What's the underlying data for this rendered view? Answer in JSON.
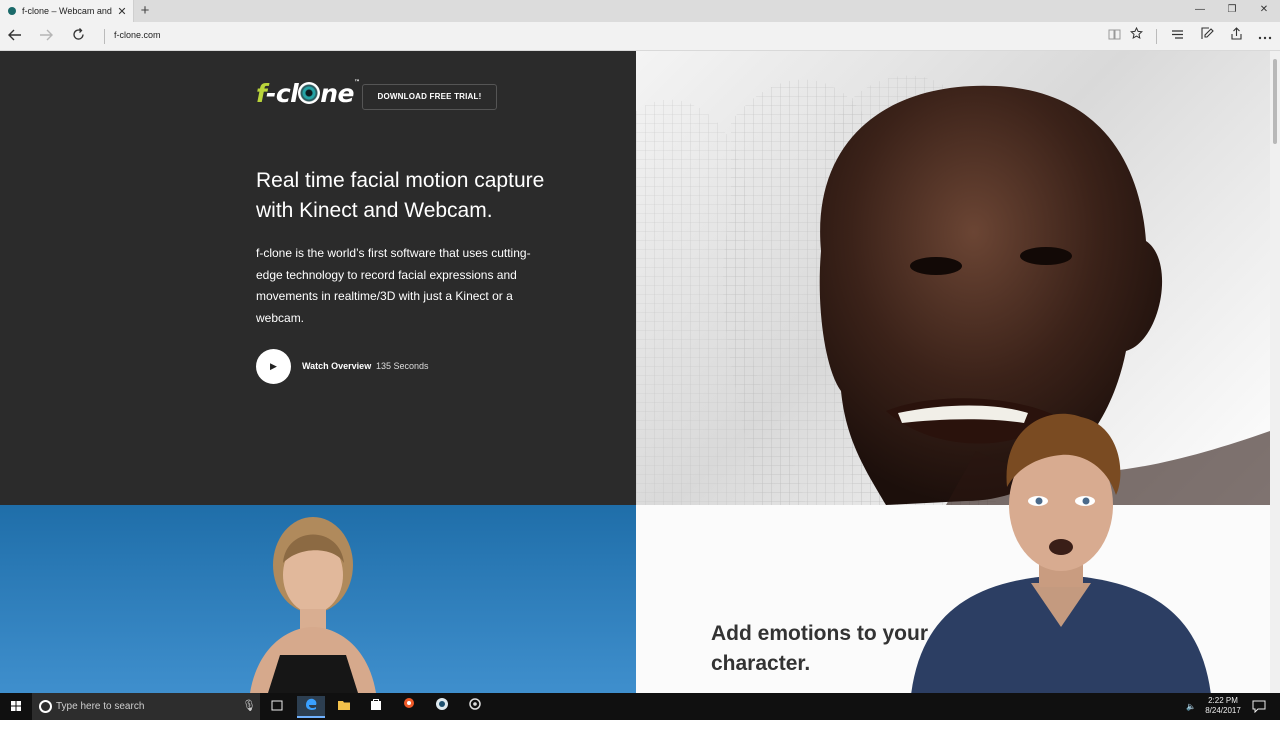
{
  "browser": {
    "tab_title": "f-clone – Webcam and I",
    "tab_close": "✕",
    "new_tab": "+",
    "url": "f-clone.com",
    "window_controls": [
      "—",
      "❐",
      "✕"
    ],
    "accent": "#b9d43a"
  },
  "page": {
    "logo": {
      "prefix": "f",
      "middle": "-cl",
      "suffix": "ne",
      "tm": "™"
    },
    "download_button": "DOWNLOAD FREE TRIAL!",
    "headline": "Real time facial motion capture with Kinect and Webcam.",
    "description": "f-clone is the world’s first software that uses cutting-edge technology to record facial expressions and movements in realtime/3D with just a Kinect or a webcam.",
    "play_icon": "▶",
    "watch_label": "Watch Overview",
    "watch_duration": "135 Seconds",
    "section2_heading": "Add emotions to your character."
  },
  "taskbar": {
    "search_placeholder": "Type here to search",
    "time": "2:22 PM",
    "date": "8/24/2017"
  }
}
